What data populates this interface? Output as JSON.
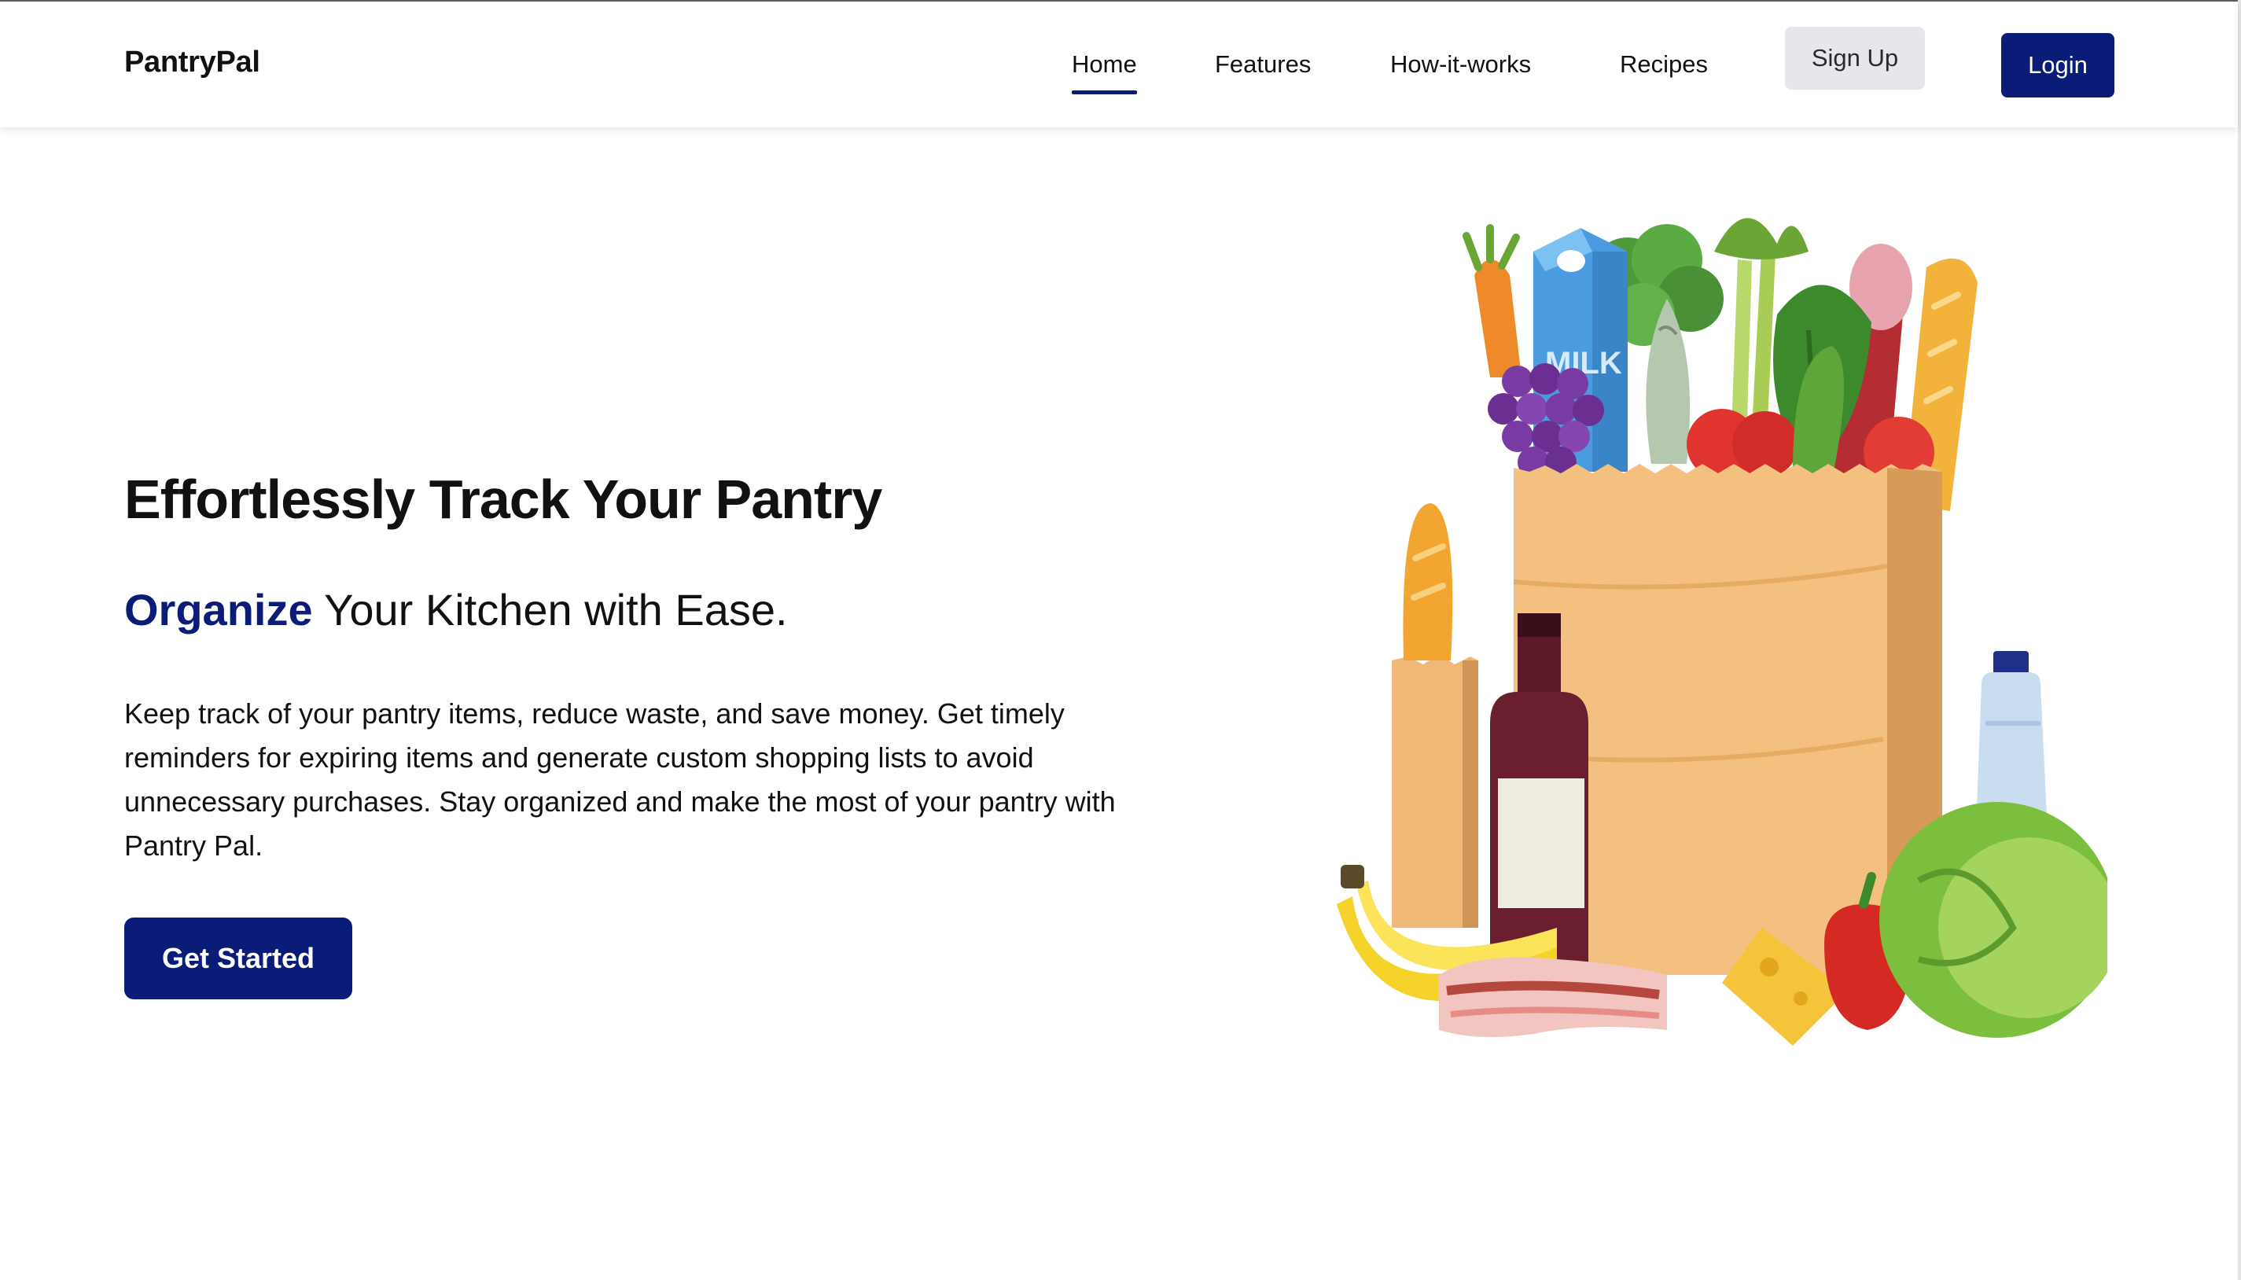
{
  "navbar": {
    "brand": "PantryPal",
    "links": [
      {
        "label": "Home",
        "active": true
      },
      {
        "label": "Features",
        "active": false
      },
      {
        "label": "How-it-works",
        "active": false
      },
      {
        "label": "Recipes",
        "active": false
      }
    ],
    "signup_label": "Sign Up",
    "login_label": "Login"
  },
  "hero": {
    "title": "Effortlessly Track Your Pantry",
    "subtitle_accent": "Organize",
    "subtitle_rest": " Your Kitchen with Ease.",
    "body": "Keep track of your pantry items, reduce waste, and save money. Get timely reminders for expiring items and generate custom shopping lists to avoid unnecessary purchases. Stay organized and make the most of your pantry with Pantry Pal.",
    "cta_label": "Get Started"
  },
  "illustration": {
    "milk_label": "MILK"
  },
  "colors": {
    "brand_navy": "#0b1b78",
    "signup_bg": "#e5e7eb",
    "text": "#111111"
  }
}
